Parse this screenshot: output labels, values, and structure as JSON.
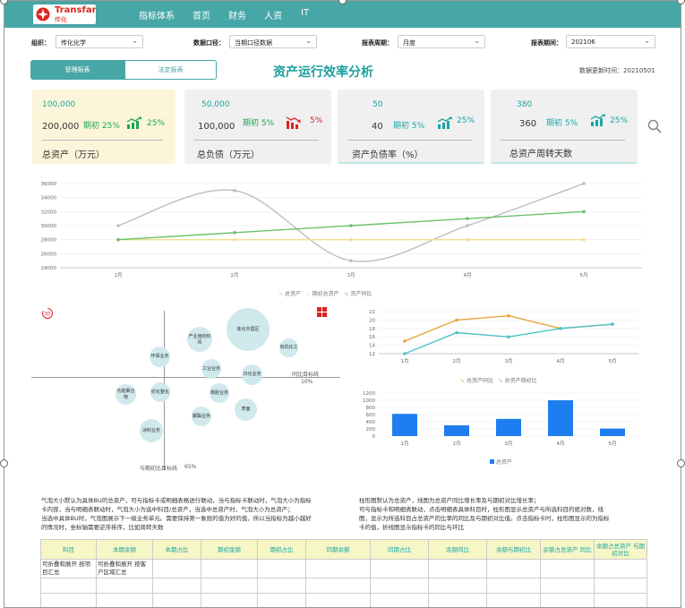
{
  "header": {
    "logo_en": "Transfar",
    "logo_cn": "传化",
    "nav": [
      "指标体系",
      "首页",
      "财务",
      "人资",
      "IT"
    ]
  },
  "filters": {
    "org_label": "组织：",
    "org_value": "传化化学",
    "scope_label": "数据口径：",
    "scope_value": "当期口径数据",
    "cycle_label": "报表周期：",
    "cycle_value": "月度",
    "period_label": "报表期间：",
    "period_value": "202106"
  },
  "tabs": {
    "active": "管理报表",
    "inactive": "法定报表"
  },
  "page_title": "资产运行效率分析",
  "update_text": "数据更新时间：20210501",
  "cards": [
    {
      "v1": "100,000",
      "v2": "200,000",
      "mid": "期初 25%",
      "pct": "25%",
      "trend": "up",
      "name": "总资产（万元）"
    },
    {
      "v1": "50,000",
      "v2": "100,000",
      "mid": "期初 5%",
      "pct": "5%",
      "trend": "down",
      "name": "总负债（万元）"
    },
    {
      "v1": "50",
      "v2": "40",
      "mid": "期初 5%",
      "pct": "25%",
      "trend": "up",
      "name": "资产负债率（%）"
    },
    {
      "v1": "380",
      "v2": "360",
      "mid": "期初 5%",
      "pct": "25%",
      "trend": "up",
      "name": "总资产周转天数"
    }
  ],
  "colors": {
    "teal": "#47a6a6",
    "green": "#1aa650",
    "red": "#e02020",
    "gray_line": "#bdbdbd",
    "green_line": "#6cc26c",
    "yellow_line": "#f5dc8e",
    "bar": "#1e7ef0",
    "orange": "#e8a33c",
    "cyan": "#4cc3c6"
  },
  "chart_data": [
    {
      "type": "line",
      "categories": [
        "1月",
        "2月",
        "3月",
        "4月",
        "5月"
      ],
      "ylim": [
        24000,
        36000
      ],
      "yticks": [
        "36000",
        "34000",
        "32000",
        "30000",
        "28000",
        "26000",
        "24000"
      ],
      "series": [
        {
          "name": "总资产",
          "values": [
            30000,
            35000,
            25000,
            30000,
            36000
          ],
          "smooth": true
        },
        {
          "name": "期初总资产",
          "values": [
            28000,
            28000,
            28000,
            28000,
            28000
          ]
        },
        {
          "name": "资产同比",
          "values": [
            28000,
            29000,
            30000,
            31000,
            32000
          ]
        }
      ]
    },
    {
      "type": "scatter",
      "xaxis_label": "同比目标线",
      "xaxis_value": "10%",
      "yaxis_label": "与期初比目标线",
      "yaxis_value": "65%",
      "bubbles": [
        "炼化中国区",
        "产业用纺织品",
        "有机化工",
        "环保业务",
        "工业业务",
        "日化业务",
        "功能聚合物",
        "纺化整化",
        "橡胶业务",
        "聚酯业务",
        "表面",
        "涂料业务"
      ]
    },
    {
      "type": "line",
      "categories": [
        "1月",
        "2月",
        "3月",
        "4月",
        "5月"
      ],
      "ylim": [
        12,
        22
      ],
      "yticks": [
        "22",
        "20",
        "18",
        "16",
        "14",
        "12"
      ],
      "series": [
        {
          "name": "总资产同比",
          "values": [
            15,
            20,
            21,
            18,
            19
          ]
        },
        {
          "name": "总资产期初比",
          "values": [
            12,
            17,
            16,
            18,
            19
          ]
        }
      ]
    },
    {
      "type": "bar",
      "categories": [
        "1月",
        "2月",
        "3月",
        "4月",
        "5月"
      ],
      "ylim": [
        0,
        1200
      ],
      "yticks": [
        "1200",
        "1000",
        "800",
        "600",
        "400",
        "200",
        "0"
      ],
      "series": [
        {
          "name": "总资产",
          "values": [
            620,
            300,
            480,
            1000,
            210
          ]
        }
      ]
    }
  ],
  "desc_left": [
    "气泡大小默认为具体BU的总资产，可与指标卡或明细表格进行联动，当与指标卡联动时，气泡大小为指标",
    "卡内容，当与明细表联动时，气泡大小为选中科目/总资产，当选中总资产时，气泡大小为总资产；",
    "当选中具体BU时，气泡图展示下一级业务单元。需要保持第一象限的值为好的值，所以当指标为越小越好",
    "的情况时，坐标轴需要逆序排序，比如周转天数"
  ],
  "desc_right": [
    "柱形图默认为总资产，线图为总资产同比增长率及与期初对比增长率；",
    "可与指标卡和明细表联动，点击明细表具体科目时，柱形图显示总资产与所选科目的绝对数，线",
    "图，显示为所选科目占总资产的比率的同比及与期初对比值。点击指标卡时，柱形图显示的为指标",
    "卡的值，折线图显示指标卡的同比与环比"
  ],
  "table": {
    "headers": [
      "科目",
      "本期余额",
      "本期占比",
      "期初金额",
      "期初占比",
      "同期余额",
      "同期占比",
      "余额同比",
      "余额与期初比",
      "余额占总资产 同比",
      "余额占总资产 与期初对比"
    ],
    "row1": [
      "可折叠和展开 按项目汇总",
      "可折叠和展开 按客户区域汇总"
    ]
  }
}
